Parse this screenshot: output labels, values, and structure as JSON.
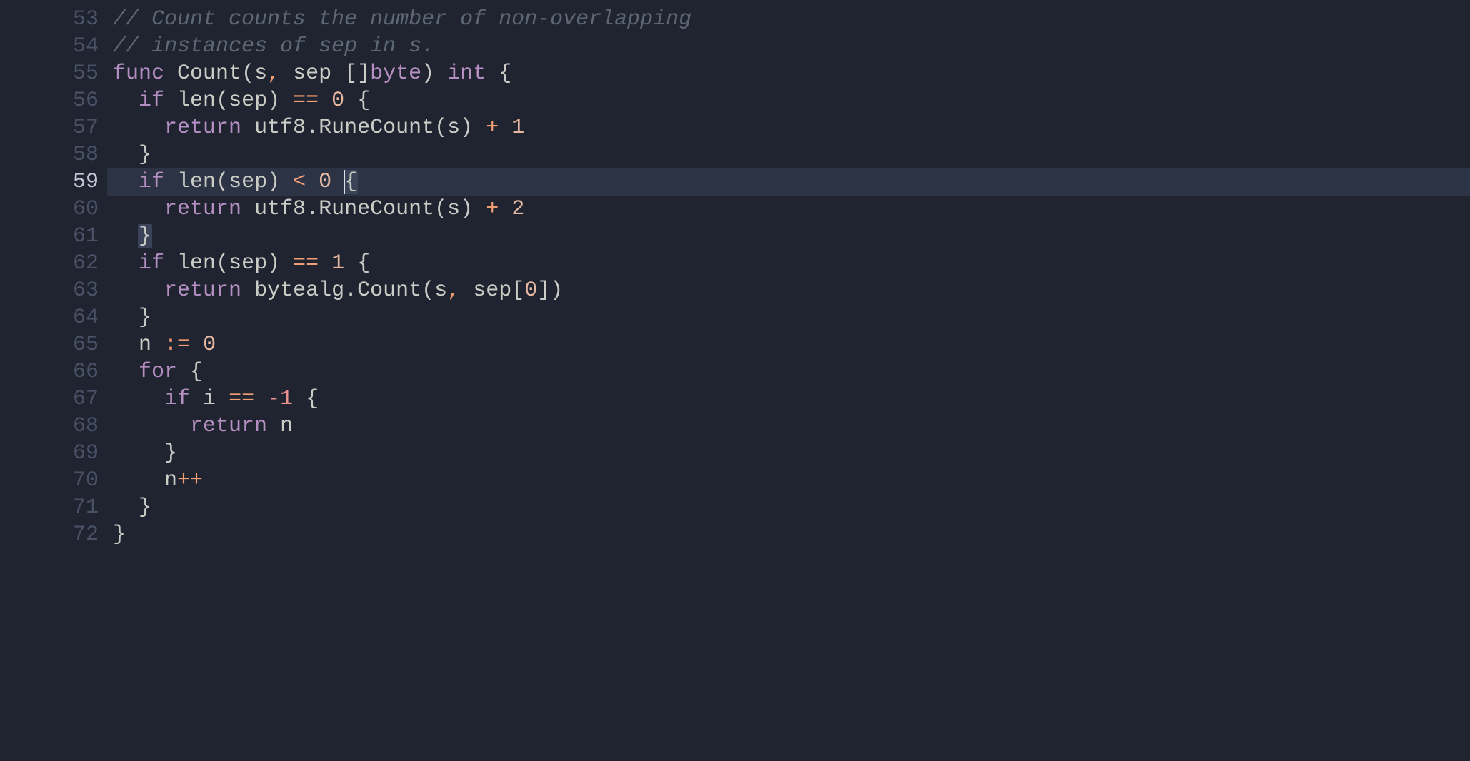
{
  "editor": {
    "language": "go",
    "active_line": 59,
    "lines": [
      {
        "num": 53,
        "active": false,
        "tokens": [
          {
            "cls": "tok-comment",
            "t": "// Count counts the number of non-overlapping"
          }
        ]
      },
      {
        "num": 54,
        "active": false,
        "tokens": [
          {
            "cls": "tok-comment",
            "t": "// instances of sep in s."
          }
        ]
      },
      {
        "num": 55,
        "active": false,
        "tokens": [
          {
            "cls": "tok-keyword",
            "t": "func"
          },
          {
            "cls": "",
            "t": " "
          },
          {
            "cls": "tok-funcname",
            "t": "Count"
          },
          {
            "cls": "tok-paren",
            "t": "("
          },
          {
            "cls": "tok-ident",
            "t": "s"
          },
          {
            "cls": "tok-op",
            "t": ","
          },
          {
            "cls": "",
            "t": " "
          },
          {
            "cls": "tok-ident",
            "t": "sep"
          },
          {
            "cls": "",
            "t": " "
          },
          {
            "cls": "tok-paren",
            "t": "[]"
          },
          {
            "cls": "tok-keyword",
            "t": "byte"
          },
          {
            "cls": "tok-paren",
            "t": ")"
          },
          {
            "cls": "",
            "t": " "
          },
          {
            "cls": "tok-keyword",
            "t": "int"
          },
          {
            "cls": "",
            "t": " "
          },
          {
            "cls": "tok-brace",
            "t": "{"
          }
        ]
      },
      {
        "num": 56,
        "active": false,
        "tokens": [
          {
            "cls": "",
            "t": "  "
          },
          {
            "cls": "tok-keyword",
            "t": "if"
          },
          {
            "cls": "",
            "t": " "
          },
          {
            "cls": "tok-builtin",
            "t": "len"
          },
          {
            "cls": "tok-paren",
            "t": "("
          },
          {
            "cls": "tok-ident",
            "t": "sep"
          },
          {
            "cls": "tok-paren",
            "t": ")"
          },
          {
            "cls": "",
            "t": " "
          },
          {
            "cls": "tok-op",
            "t": "=="
          },
          {
            "cls": "",
            "t": " "
          },
          {
            "cls": "tok-num",
            "t": "0"
          },
          {
            "cls": "",
            "t": " "
          },
          {
            "cls": "tok-brace",
            "t": "{"
          }
        ]
      },
      {
        "num": 57,
        "active": false,
        "tokens": [
          {
            "cls": "",
            "t": "    "
          },
          {
            "cls": "tok-keyword",
            "t": "return"
          },
          {
            "cls": "",
            "t": " "
          },
          {
            "cls": "tok-ident",
            "t": "utf8"
          },
          {
            "cls": "tok-dot",
            "t": "."
          },
          {
            "cls": "tok-ident",
            "t": "RuneCount"
          },
          {
            "cls": "tok-paren",
            "t": "("
          },
          {
            "cls": "tok-ident",
            "t": "s"
          },
          {
            "cls": "tok-paren",
            "t": ")"
          },
          {
            "cls": "",
            "t": " "
          },
          {
            "cls": "tok-op",
            "t": "+"
          },
          {
            "cls": "",
            "t": " "
          },
          {
            "cls": "tok-num",
            "t": "1"
          }
        ]
      },
      {
        "num": 58,
        "active": false,
        "tokens": [
          {
            "cls": "",
            "t": "  "
          },
          {
            "cls": "tok-brace",
            "t": "}"
          }
        ]
      },
      {
        "num": 59,
        "active": true,
        "tokens": [
          {
            "cls": "",
            "t": "  "
          },
          {
            "cls": "tok-keyword",
            "t": "if"
          },
          {
            "cls": "",
            "t": " "
          },
          {
            "cls": "tok-builtin",
            "t": "len"
          },
          {
            "cls": "tok-paren",
            "t": "("
          },
          {
            "cls": "tok-ident",
            "t": "sep"
          },
          {
            "cls": "tok-paren",
            "t": ")"
          },
          {
            "cls": "",
            "t": " "
          },
          {
            "cls": "tok-op",
            "t": "<"
          },
          {
            "cls": "",
            "t": " "
          },
          {
            "cls": "tok-num",
            "t": "0"
          },
          {
            "cls": "",
            "t": " "
          },
          {
            "cls": "tok-brace hl-brace cursor-slot",
            "t": "{"
          }
        ]
      },
      {
        "num": 60,
        "active": false,
        "tokens": [
          {
            "cls": "",
            "t": "    "
          },
          {
            "cls": "tok-keyword",
            "t": "return"
          },
          {
            "cls": "",
            "t": " "
          },
          {
            "cls": "tok-ident",
            "t": "utf8"
          },
          {
            "cls": "tok-dot",
            "t": "."
          },
          {
            "cls": "tok-ident",
            "t": "RuneCount"
          },
          {
            "cls": "tok-paren",
            "t": "("
          },
          {
            "cls": "tok-ident",
            "t": "s"
          },
          {
            "cls": "tok-paren",
            "t": ")"
          },
          {
            "cls": "",
            "t": " "
          },
          {
            "cls": "tok-op",
            "t": "+"
          },
          {
            "cls": "",
            "t": " "
          },
          {
            "cls": "tok-num",
            "t": "2"
          }
        ]
      },
      {
        "num": 61,
        "active": false,
        "tokens": [
          {
            "cls": "",
            "t": "  "
          },
          {
            "cls": "tok-brace hl-brace",
            "t": "}"
          }
        ]
      },
      {
        "num": 62,
        "active": false,
        "tokens": [
          {
            "cls": "",
            "t": "  "
          },
          {
            "cls": "tok-keyword",
            "t": "if"
          },
          {
            "cls": "",
            "t": " "
          },
          {
            "cls": "tok-builtin",
            "t": "len"
          },
          {
            "cls": "tok-paren",
            "t": "("
          },
          {
            "cls": "tok-ident",
            "t": "sep"
          },
          {
            "cls": "tok-paren",
            "t": ")"
          },
          {
            "cls": "",
            "t": " "
          },
          {
            "cls": "tok-op",
            "t": "=="
          },
          {
            "cls": "",
            "t": " "
          },
          {
            "cls": "tok-num",
            "t": "1"
          },
          {
            "cls": "",
            "t": " "
          },
          {
            "cls": "tok-brace",
            "t": "{"
          }
        ]
      },
      {
        "num": 63,
        "active": false,
        "tokens": [
          {
            "cls": "",
            "t": "    "
          },
          {
            "cls": "tok-keyword",
            "t": "return"
          },
          {
            "cls": "",
            "t": " "
          },
          {
            "cls": "tok-ident",
            "t": "bytealg"
          },
          {
            "cls": "tok-dot",
            "t": "."
          },
          {
            "cls": "tok-ident",
            "t": "Count"
          },
          {
            "cls": "tok-paren",
            "t": "("
          },
          {
            "cls": "tok-ident",
            "t": "s"
          },
          {
            "cls": "tok-op",
            "t": ","
          },
          {
            "cls": "",
            "t": " "
          },
          {
            "cls": "tok-ident",
            "t": "sep"
          },
          {
            "cls": "tok-paren",
            "t": "["
          },
          {
            "cls": "tok-num",
            "t": "0"
          },
          {
            "cls": "tok-paren",
            "t": "]"
          },
          {
            "cls": "tok-paren",
            "t": ")"
          }
        ]
      },
      {
        "num": 64,
        "active": false,
        "tokens": [
          {
            "cls": "",
            "t": "  "
          },
          {
            "cls": "tok-brace",
            "t": "}"
          }
        ]
      },
      {
        "num": 65,
        "active": false,
        "tokens": [
          {
            "cls": "",
            "t": "  "
          },
          {
            "cls": "tok-ident",
            "t": "n"
          },
          {
            "cls": "",
            "t": " "
          },
          {
            "cls": "tok-op",
            "t": ":="
          },
          {
            "cls": "",
            "t": " "
          },
          {
            "cls": "tok-num",
            "t": "0"
          }
        ]
      },
      {
        "num": 66,
        "active": false,
        "tokens": [
          {
            "cls": "",
            "t": "  "
          },
          {
            "cls": "tok-keyword",
            "t": "for"
          },
          {
            "cls": "",
            "t": " "
          },
          {
            "cls": "tok-brace",
            "t": "{"
          }
        ]
      },
      {
        "num": 67,
        "active": false,
        "tokens": [
          {
            "cls": "",
            "t": "    "
          },
          {
            "cls": "tok-keyword",
            "t": "if"
          },
          {
            "cls": "",
            "t": " "
          },
          {
            "cls": "tok-ident",
            "t": "i"
          },
          {
            "cls": "",
            "t": " "
          },
          {
            "cls": "tok-op",
            "t": "=="
          },
          {
            "cls": "",
            "t": " "
          },
          {
            "cls": "tok-neg",
            "t": "-1"
          },
          {
            "cls": "",
            "t": " "
          },
          {
            "cls": "tok-brace",
            "t": "{"
          }
        ]
      },
      {
        "num": 68,
        "active": false,
        "tokens": [
          {
            "cls": "",
            "t": "      "
          },
          {
            "cls": "tok-keyword",
            "t": "return"
          },
          {
            "cls": "",
            "t": " "
          },
          {
            "cls": "tok-ident",
            "t": "n"
          }
        ]
      },
      {
        "num": 69,
        "active": false,
        "tokens": [
          {
            "cls": "",
            "t": "    "
          },
          {
            "cls": "tok-brace",
            "t": "}"
          }
        ]
      },
      {
        "num": 70,
        "active": false,
        "tokens": [
          {
            "cls": "",
            "t": "    "
          },
          {
            "cls": "tok-ident",
            "t": "n"
          },
          {
            "cls": "tok-op",
            "t": "++"
          }
        ]
      },
      {
        "num": 71,
        "active": false,
        "tokens": [
          {
            "cls": "",
            "t": "  "
          },
          {
            "cls": "tok-brace",
            "t": "}"
          }
        ]
      },
      {
        "num": 72,
        "active": false,
        "tokens": [
          {
            "cls": "tok-brace",
            "t": "}"
          }
        ]
      }
    ]
  }
}
